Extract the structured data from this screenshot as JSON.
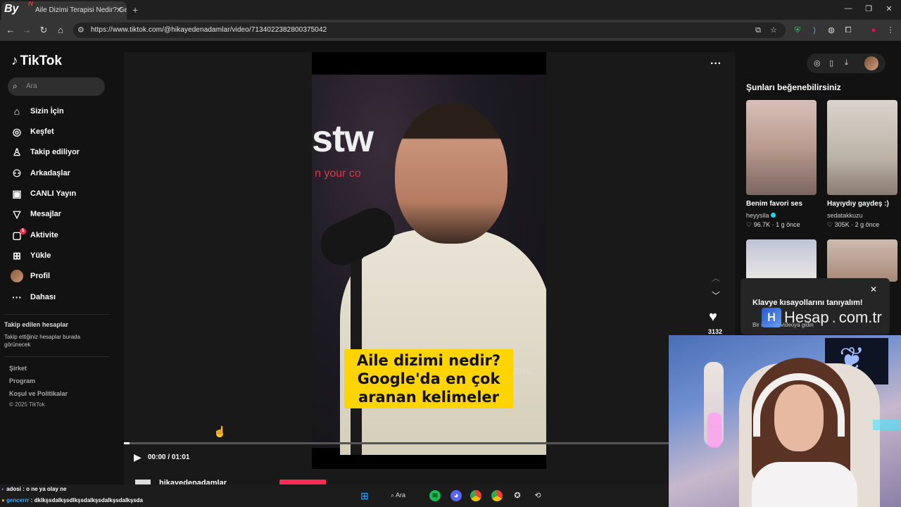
{
  "browser": {
    "tab_title": "Aile Dizimi Terapisi Nedir? Geç",
    "tab_logo": "By",
    "tab_logo_badge": "N",
    "url": "https://www.tiktok.com/@hikayedenadamlar/video/7134022382800375042"
  },
  "tiktok": {
    "brand": "TikTok",
    "search_placeholder": "Ara",
    "nav": [
      {
        "label": "Sizin İçin",
        "icon": "home-icon"
      },
      {
        "label": "Keşfet",
        "icon": "compass-icon"
      },
      {
        "label": "Takip ediliyor",
        "icon": "following-icon"
      },
      {
        "label": "Arkadaşlar",
        "icon": "friends-icon"
      },
      {
        "label": "CANLI Yayın",
        "icon": "live-icon"
      },
      {
        "label": "Mesajlar",
        "icon": "messages-icon"
      },
      {
        "label": "Aktivite",
        "icon": "activity-icon",
        "badge": "5"
      },
      {
        "label": "Yükle",
        "icon": "upload-icon"
      },
      {
        "label": "Profil",
        "icon": "avatar"
      },
      {
        "label": "Dahası",
        "icon": "more-icon"
      }
    ],
    "following_title": "Takip edilen hesaplar",
    "following_desc": "Takip ettiğiniz hesaplar burada görünecek",
    "footer_links": [
      "Şirket",
      "Program",
      "Koşul ve Politikalar"
    ],
    "copyright": "© 2025 TikTok"
  },
  "video": {
    "wall_text": "stw",
    "wall_sub": "n your co",
    "caption_lines": [
      "Aile dizimi nedir?",
      "Google'da en çok",
      "aranan kelimeler"
    ],
    "corner_text": "CIAL",
    "time": "00:00 / 01:01",
    "progress": 0.01,
    "author": "hikayedenadamlar",
    "likes": "3132"
  },
  "recommendations": {
    "title": "Şunları beğenebilirsiniz",
    "items": [
      {
        "title": "Benim favori ses",
        "user": "heyysila",
        "verified": true,
        "likes": "96.7K",
        "age": "1 g önce"
      },
      {
        "title": "Hayıydıy gaydeş :)",
        "user": "sedatakkuzu",
        "verified": false,
        "likes": "305K",
        "age": "2 g önce"
      }
    ]
  },
  "popup": {
    "title": "Klavye kısayollarını tanıyalım!",
    "subtitle": "Bir sonraki videoya gidin"
  },
  "watermark": {
    "brand": "Hesap",
    "dot": ".",
    "tld": "com.tr"
  },
  "chat": [
    {
      "user": "adosi",
      "message": " : o ne ya olay ne"
    },
    {
      "user": "gencerrr",
      "message": " : dklkşsdalkşsdlkşsdalkşsdalkşsdalkşsda"
    }
  ],
  "taskbar": {
    "search_label": "Ara"
  },
  "colors": {
    "accent": "#fe2c55",
    "caption_bg": "#ffd400",
    "bg": "#121212"
  }
}
